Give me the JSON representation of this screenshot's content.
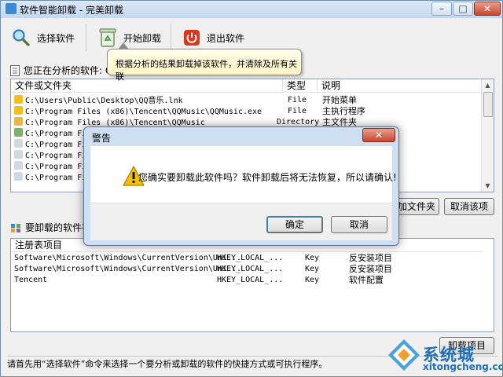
{
  "window": {
    "title": "软件智能卸载 - 完美卸载",
    "close_glyph": "✕"
  },
  "toolbar": {
    "select_label": "选择软件",
    "start_label": "开始卸载",
    "exit_label": "退出软件"
  },
  "tooltip": {
    "text": "根据分析的结果卸载掉该软件，并清除及所有关联"
  },
  "analyzing": {
    "label": "您正在分析的软件: QQ音"
  },
  "files": {
    "columns": [
      "文件或文件夹",
      "类型",
      "说明"
    ],
    "rows": [
      {
        "path": "C:\\Users\\Public\\Desktop\\QQ音乐.lnk",
        "type": "File",
        "desc": "开始菜单"
      },
      {
        "path": "C:\\Program Files (x86)\\Tencent\\QQMusic\\QQMusic.exe",
        "type": "File",
        "desc": "主执行程序"
      },
      {
        "path": "C:\\Program Files (x86)\\Tencent\\QQMusic",
        "type": "Directory",
        "desc": "主文件夹"
      },
      {
        "path": "C:\\Program Files (x",
        "type": "",
        "desc": ""
      },
      {
        "path": "C:\\Program Files (x",
        "type": "",
        "desc": ""
      },
      {
        "path": "C:\\Program Files (x",
        "type": "",
        "desc": ""
      },
      {
        "path": "C:\\Program Files (x",
        "type": "",
        "desc": ""
      },
      {
        "path": "C:\\Program Files (x",
        "type": "",
        "desc": ""
      }
    ],
    "add_folder_label": "加文件夹",
    "cancel_item_label": "取消该项"
  },
  "registry": {
    "section_label": "要卸载的软件在注册表",
    "columns": [
      "注册表项目"
    ],
    "rows": [
      {
        "path": "Software\\Microsoft\\Windows\\CurrentVersion\\Uni...",
        "root": "HKEY_LOCAL_...",
        "type": "Key",
        "desc": "反安装项目"
      },
      {
        "path": "Software\\Microsoft\\Windows\\CurrentVersion\\Uni...",
        "root": "HKEY_LOCAL_...",
        "type": "Key",
        "desc": "反安装项目"
      },
      {
        "path": "Tencent",
        "root": "HKEY_LOCAL_...",
        "type": "Key",
        "desc": "软件配置"
      }
    ],
    "button_partial": "卸载项目"
  },
  "status": {
    "text": "请首先用“选择软件”命令来选择一个要分析或卸载的软件的快捷方式或可执行程序。"
  },
  "dialog": {
    "title": "警告",
    "close_glyph": "✕",
    "message": "您确实要卸载此软件吗？软件卸载后将无法恢复，所以请确认!",
    "ok_label": "确定",
    "cancel_label": "取消"
  },
  "watermark": {
    "brand": "系统城",
    "url": "xitongcheng.com"
  },
  "colors": {
    "accent": "#3c7fb1",
    "warning": "#f2c200",
    "exit_red": "#d9381e"
  }
}
